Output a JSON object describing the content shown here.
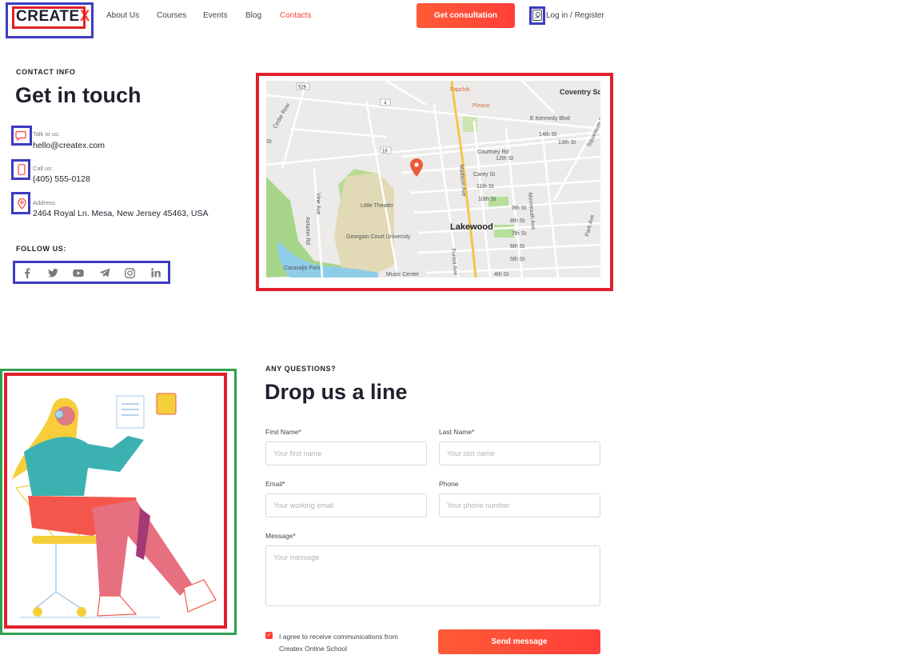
{
  "header": {
    "logo_main": "CREATE",
    "logo_x": "X",
    "nav": [
      "About Us",
      "Courses",
      "Events",
      "Blog",
      "Contacts"
    ],
    "active_nav": "Contacts",
    "cta_label": "Get consultation",
    "login_label": "Log in / Register"
  },
  "contact": {
    "eyebrow": "CONTACT INFO",
    "title": "Get in touch",
    "items": [
      {
        "label": "Talk to us:",
        "value": "hello@createx.com",
        "icon": "chat-icon"
      },
      {
        "label": "Call us:",
        "value": "(405) 555-0128",
        "icon": "phone-icon"
      },
      {
        "label": "Address:",
        "value": "2464 Royal Ln. Mesa, New Jersey 45463, USA",
        "icon": "location-pin-icon"
      }
    ],
    "follow_label": "FOLLOW US:",
    "socials": [
      "facebook-icon",
      "twitter-icon",
      "youtube-icon",
      "telegram-icon",
      "instagram-icon",
      "linkedin-icon"
    ]
  },
  "map": {
    "labels": {
      "coventry": "Coventry Square",
      "kennedy": "E Kennedy Blvd",
      "lakewood": "Lakewood",
      "theater": "Little Theater",
      "university": "Georgian Court University",
      "park": "Carasaljo Park",
      "music": "Music Center",
      "fapchik": "Fapchik",
      "pizano": "Pizano",
      "madison": "Madison Ave",
      "forest": "Forest Ave",
      "monmouth": "Monmouth Ave",
      "cedar": "Cedar Row",
      "vine": "Vine Ave",
      "courtney": "Courtney Rd",
      "carey": "Carey St",
      "park_ave": "Park Ave",
      "squankum": "Squankum Rd",
      "st": "St",
      "streets": [
        "14th St",
        "13th St",
        "12th St",
        "11th St",
        "10th St",
        "9th St",
        "8th St",
        "7th St",
        "6th St",
        "5th St",
        "4th St"
      ],
      "shields": [
        "526",
        "4",
        "16"
      ]
    }
  },
  "form": {
    "eyebrow": "ANY QUESTIONS?",
    "title": "Drop us a line",
    "first_name_label": "First Name*",
    "first_name_placeholder": "Your first name",
    "last_name_label": "Last  Name*",
    "last_name_placeholder": "Your last name",
    "email_label": "Email*",
    "email_placeholder": "Your working email",
    "phone_label": "Phone",
    "phone_placeholder": "Your phone number",
    "message_label": "Message*",
    "message_placeholder": "Your message",
    "agree_text": "I agree to receive communications from Createx Online School",
    "agree_checked": true,
    "submit_label": "Send message"
  },
  "colors": {
    "accent": "#ff3f3a",
    "dark": "#1e212c",
    "annotation_blue": "#3c3cc0",
    "annotation_red": "#e0202a",
    "annotation_green": "#30a050"
  }
}
